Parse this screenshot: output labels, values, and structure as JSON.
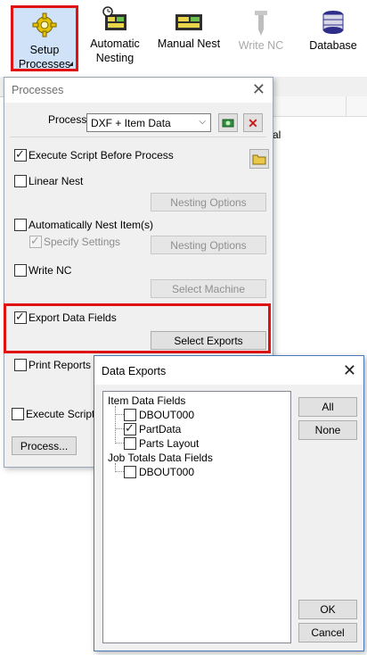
{
  "toolbar": {
    "buttons": [
      {
        "label_line1": "Setup",
        "label_line2": "Processes",
        "icon": "gear-icon",
        "active": true
      },
      {
        "label_line1": "Automatic",
        "label_line2": "Nesting",
        "icon": "auto-nest-icon"
      },
      {
        "label_line1": "Manual Nest",
        "label_line2": "",
        "icon": "manual-nest-icon"
      },
      {
        "label_line1": "Write NC",
        "label_line2": "",
        "icon": "write-nc-icon",
        "disabled": true
      },
      {
        "label_line1": "Database",
        "label_line2": "",
        "icon": "database-icon"
      }
    ]
  },
  "background": {
    "partial_text": "al"
  },
  "processes": {
    "title": "Processes",
    "process_label": "Process",
    "process_value": "DXF + Item Data",
    "options": {
      "execute_before": {
        "label": "Execute Script Before Process",
        "checked": true
      },
      "linear_nest": {
        "label": "Linear Nest",
        "checked": false,
        "button": "Nesting Options"
      },
      "auto_nest": {
        "label": "Automatically Nest Item(s)",
        "checked": false
      },
      "specify_settings": {
        "label": "Specify Settings",
        "checked": true,
        "button": "Nesting Options"
      },
      "write_nc": {
        "label": "Write NC",
        "checked": false,
        "button": "Select Machine"
      },
      "export_data": {
        "label": "Export Data Fields",
        "checked": true,
        "button": "Select Exports"
      },
      "print_reports": {
        "label": "Print Reports",
        "checked": false
      },
      "execute_after": {
        "label": "Execute Script A",
        "checked": false
      }
    },
    "process_button": "Process..."
  },
  "exports": {
    "title": "Data Exports",
    "tree": {
      "group1": "Item Data Fields",
      "items1": [
        {
          "label": "DBOUT000",
          "checked": false
        },
        {
          "label": "PartData",
          "checked": true
        },
        {
          "label": "Parts Layout",
          "checked": false
        }
      ],
      "group2": "Job Totals Data Fields",
      "items2": [
        {
          "label": "DBOUT000",
          "checked": false
        }
      ]
    },
    "buttons": {
      "all": "All",
      "none": "None",
      "ok": "OK",
      "cancel": "Cancel"
    }
  },
  "colors": {
    "highlight_red": "#e01212",
    "active_blue": "#cfe2f7"
  }
}
